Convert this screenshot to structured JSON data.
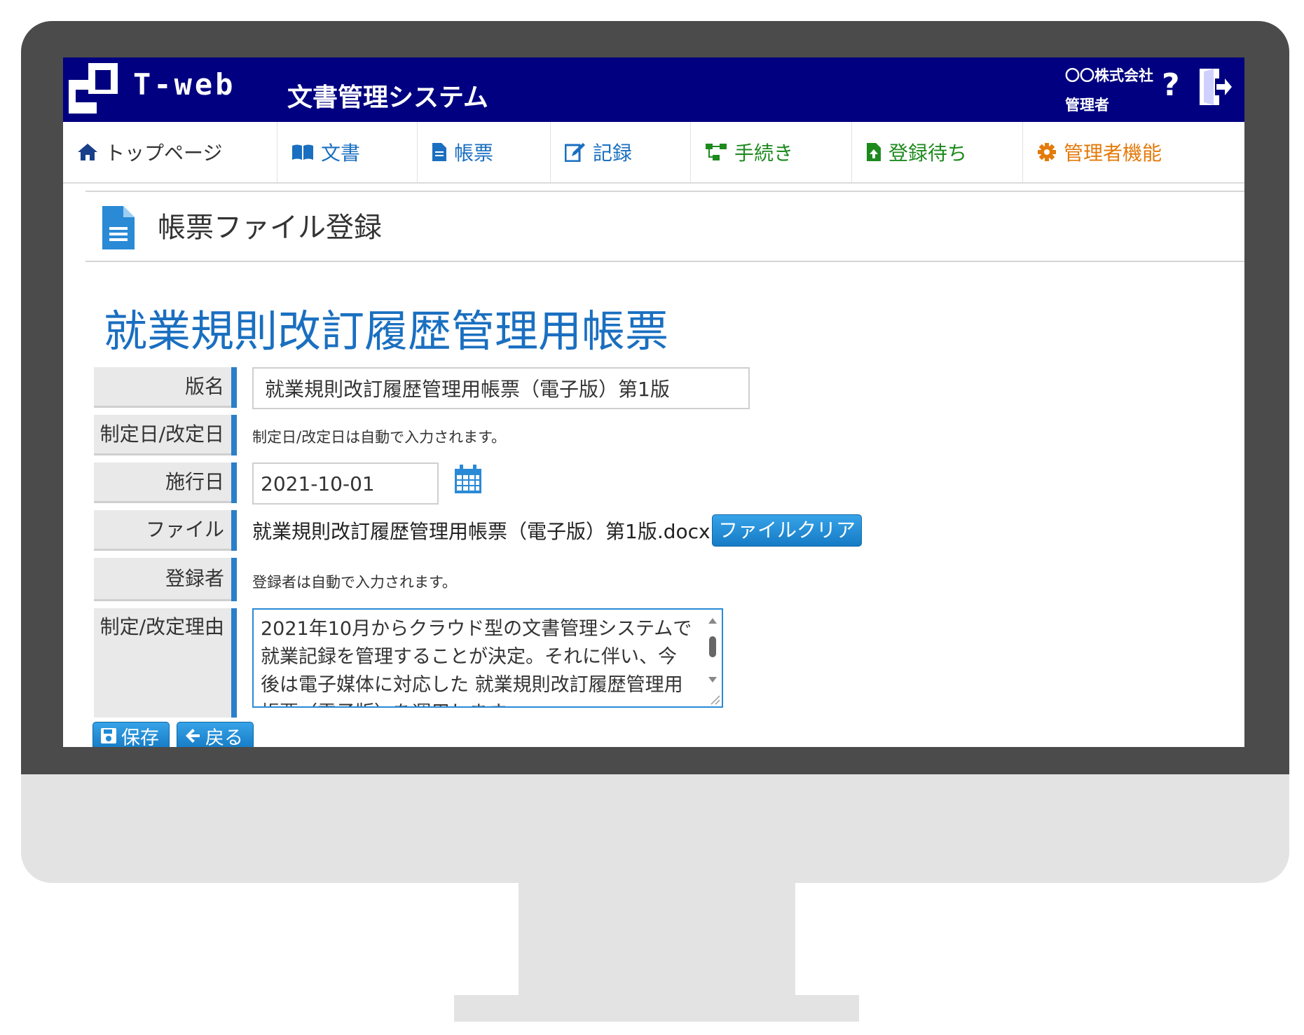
{
  "header": {
    "brand": "T-web",
    "system_title": "文書管理システム",
    "company": "〇〇株式会社",
    "role": "管理者",
    "help_label": "?"
  },
  "nav": {
    "items": [
      {
        "label": "トップページ",
        "icon": "home-icon"
      },
      {
        "label": "文書",
        "icon": "book-icon"
      },
      {
        "label": "帳票",
        "icon": "file-icon"
      },
      {
        "label": "記録",
        "icon": "edit-icon"
      },
      {
        "label": "手続き",
        "icon": "sitemap-icon"
      },
      {
        "label": "登録待ち",
        "icon": "file-upload-icon"
      },
      {
        "label": "管理者機能",
        "icon": "gear-icon"
      }
    ]
  },
  "page": {
    "title": "帳票ファイル登録",
    "form_title": "就業規則改訂履歴管理用帳票"
  },
  "form": {
    "edition_label": "版名",
    "edition_value": "就業規則改訂履歴管理用帳票（電子版）第1版",
    "date_label": "制定日/改定日",
    "date_note": "制定日/改定日は自動で入力されます。",
    "effective_label": "施行日",
    "effective_value": "2021-10-01",
    "file_label": "ファイル",
    "file_name": "就業規則改訂履歴管理用帳票（電子版）第1版.docx",
    "file_clear_label": "ファイルクリア",
    "registrant_label": "登録者",
    "registrant_note": "登録者は自動で入力されます。",
    "reason_label": "制定/改定理由",
    "reason_value": "2021年10月からクラウド型の文書管理システムで就業記録を管理することが決定。それに伴い、今後は電子媒体に対応した 就業規則改訂履歴管理用帳票（電子版）を運用します。"
  },
  "actions": {
    "save_label": "保存",
    "back_label": "戻る"
  },
  "colors": {
    "header_bg": "#000080",
    "accent": "#1a6fc0",
    "button": "#1f8ad6",
    "admin": "#e47a0b",
    "green": "#1d8a1d"
  }
}
